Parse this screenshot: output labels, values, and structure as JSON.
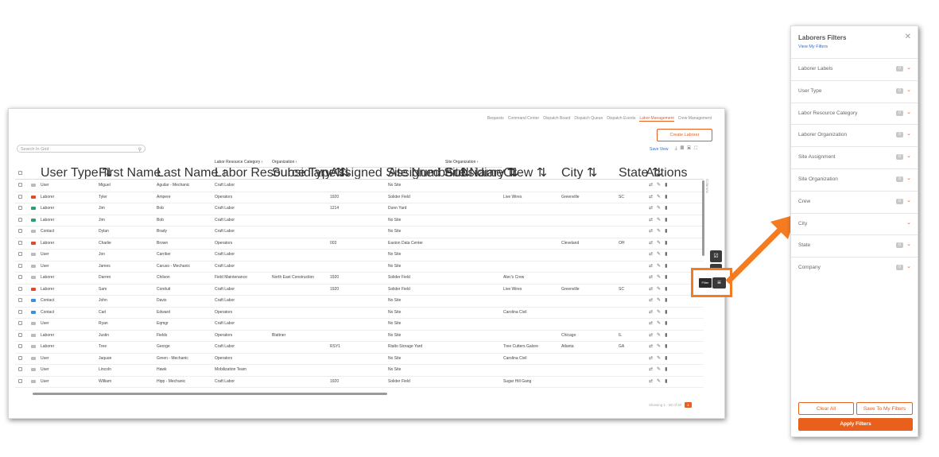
{
  "nav": {
    "items": [
      "Requests",
      "Command Center",
      "Dispatch Board",
      "Dispatch Queue",
      "Dispatch Events",
      "Labor Management",
      "Crew Management"
    ],
    "active_index": 5
  },
  "toolbar": {
    "create_label": "Create Laborer",
    "search_placeholder": "Search In Grid",
    "save_view": "Save View"
  },
  "grid": {
    "group_headers": {
      "labor": "Labor Resource Category ›",
      "org": "Organization ›",
      "siteorg": "Site Organization ›"
    },
    "columns": [
      "User Type ⇅",
      "First Name",
      "Last Name ↑",
      "Labor Resource Type ⇅",
      "Subsidiary ⇅",
      "Assigned Site Number ⇅",
      "Assigned Site Name ⇅",
      "Subsidiary ⇅",
      "Crew ⇅",
      "City ⇅",
      "State ⇅",
      "Actions"
    ],
    "columns_tab": "Columns",
    "rows": [
      {
        "tag": "#bbbbbb",
        "type": "User",
        "first": "Miguel",
        "last": "Aguilar - Mechanic",
        "lrt": "Craft Labor",
        "sub": "",
        "num": "",
        "site": "No Site",
        "crew": "",
        "city": "",
        "state": ""
      },
      {
        "tag": "#e04a2a",
        "type": "Laborer",
        "first": "Tyler",
        "last": "Ampere",
        "lrt": "Operators",
        "sub": "",
        "num": "1920",
        "site": "Solider Field",
        "crew": "Live Wires",
        "city": "Greenville",
        "state": "SC"
      },
      {
        "tag": "#2e9e6a",
        "type": "Laborer",
        "first": "Jim",
        "last": "Bob",
        "lrt": "Craft Labor",
        "sub": "",
        "num": "1214",
        "site": "Dunn Yard",
        "crew": "",
        "city": "",
        "state": ""
      },
      {
        "tag": "#2e9e6a",
        "type": "Laborer",
        "first": "Jim",
        "last": "Bob",
        "lrt": "Craft Labor",
        "sub": "",
        "num": "",
        "site": "No Site",
        "crew": "",
        "city": "",
        "state": ""
      },
      {
        "tag": "#bbbbbb",
        "type": "Contact",
        "first": "Dylan",
        "last": "Brady",
        "lrt": "Craft Labor",
        "sub": "",
        "num": "",
        "site": "No Site",
        "crew": "",
        "city": "",
        "state": ""
      },
      {
        "tag": "#e04a2a",
        "type": "Laborer",
        "first": "Charlie",
        "last": "Brown",
        "lrt": "Operators",
        "sub": "",
        "num": "003",
        "site": "Easton Data Center",
        "crew": "",
        "city": "Cleveland",
        "state": "OH"
      },
      {
        "tag": "#bbbbbb",
        "type": "User",
        "first": "Jon",
        "last": "Carriker",
        "lrt": "Craft Labor",
        "sub": "",
        "num": "",
        "site": "No Site",
        "crew": "",
        "city": "",
        "state": ""
      },
      {
        "tag": "#bbbbbb",
        "type": "User",
        "first": "James",
        "last": "Caruso - Mechanic",
        "lrt": "Craft Labor",
        "sub": "",
        "num": "",
        "site": "No Site",
        "crew": "",
        "city": "",
        "state": ""
      },
      {
        "tag": "#bbbbbb",
        "type": "Laborer",
        "first": "Darren",
        "last": "Chilson",
        "lrt": "Field Maintenance",
        "sub": "North East Construction",
        "num": "1920",
        "site": "Solider Field",
        "crew": "Alec's Crew",
        "city": "",
        "state": ""
      },
      {
        "tag": "#e04a2a",
        "type": "Laborer",
        "first": "Sam",
        "last": "Conduit",
        "lrt": "Craft Labor",
        "sub": "",
        "num": "1920",
        "site": "Solider Field",
        "crew": "Live Wires",
        "city": "Greenville",
        "state": "SC"
      },
      {
        "tag": "#3d8fd8",
        "type": "Contact",
        "first": "John",
        "last": "Davis",
        "lrt": "Craft Labor",
        "sub": "",
        "num": "",
        "site": "No Site",
        "crew": "",
        "city": "",
        "state": ""
      },
      {
        "tag": "#3d8fd8",
        "type": "Contact",
        "first": "Carl",
        "last": "Edward",
        "lrt": "Operators",
        "sub": "",
        "num": "",
        "site": "No Site",
        "crew": "Carolina Civil",
        "city": "",
        "state": ""
      },
      {
        "tag": "#bbbbbb",
        "type": "User",
        "first": "Ryan",
        "last": "Eqmgr",
        "lrt": "Craft Labor",
        "sub": "",
        "num": "",
        "site": "No Site",
        "crew": "",
        "city": "",
        "state": ""
      },
      {
        "tag": "#bbbbbb",
        "type": "Laborer",
        "first": "Justin",
        "last": "Fields",
        "lrt": "Operators",
        "sub": "Blattner",
        "num": "",
        "site": "No Site",
        "crew": "",
        "city": "Chicago",
        "state": "IL"
      },
      {
        "tag": "#bbbbbb",
        "type": "Laborer",
        "first": "Tree",
        "last": "George",
        "lrt": "Craft Labor",
        "sub": "",
        "num": "RSY1",
        "site": "Rialto Storage Yard",
        "crew": "Tree Cutters Galore",
        "city": "Atlanta",
        "state": "GA"
      },
      {
        "tag": "#bbbbbb",
        "type": "User",
        "first": "Jaquan",
        "last": "Green - Mechanic",
        "lrt": "Operators",
        "sub": "",
        "num": "",
        "site": "No Site",
        "crew": "Carolina Civil",
        "city": "",
        "state": ""
      },
      {
        "tag": "#bbbbbb",
        "type": "User",
        "first": "Lincoln",
        "last": "Hawk",
        "lrt": "Mobilization Team",
        "sub": "",
        "num": "",
        "site": "No Site",
        "crew": "",
        "city": "",
        "state": ""
      },
      {
        "tag": "#bbbbbb",
        "type": "User",
        "first": "William",
        "last": "Hipp - Mechanic",
        "lrt": "Craft Labor",
        "sub": "",
        "num": "1920",
        "site": "Solider Field",
        "crew": "Sugar Hill Gang",
        "city": "",
        "state": ""
      }
    ],
    "pager": {
      "text": "Showing 1 - 50 of 50",
      "page": "1"
    }
  },
  "filter_tooltip": "Filter",
  "panel": {
    "title": "Laborers Filters",
    "link": "View My Filters",
    "filters": [
      {
        "label": "Laborer Labels",
        "count": "0"
      },
      {
        "label": "User Type",
        "count": "0"
      },
      {
        "label": "Labor Resource Category",
        "count": "0"
      },
      {
        "label": "Laborer Organization",
        "count": "0"
      },
      {
        "label": "Site Assignment",
        "count": "0"
      },
      {
        "label": "Site Organization",
        "count": "0"
      },
      {
        "label": "Crew",
        "count": "0"
      },
      {
        "label": "City",
        "count": ""
      },
      {
        "label": "State",
        "count": "0"
      },
      {
        "label": "Company",
        "count": "0"
      }
    ],
    "clear_label": "Clear All",
    "save_label": "Save To My Filters",
    "apply_label": "Apply Filters"
  },
  "colors": {
    "accent": "#e8601c",
    "arrow": "#f47b20",
    "link": "#2e6fd1"
  }
}
